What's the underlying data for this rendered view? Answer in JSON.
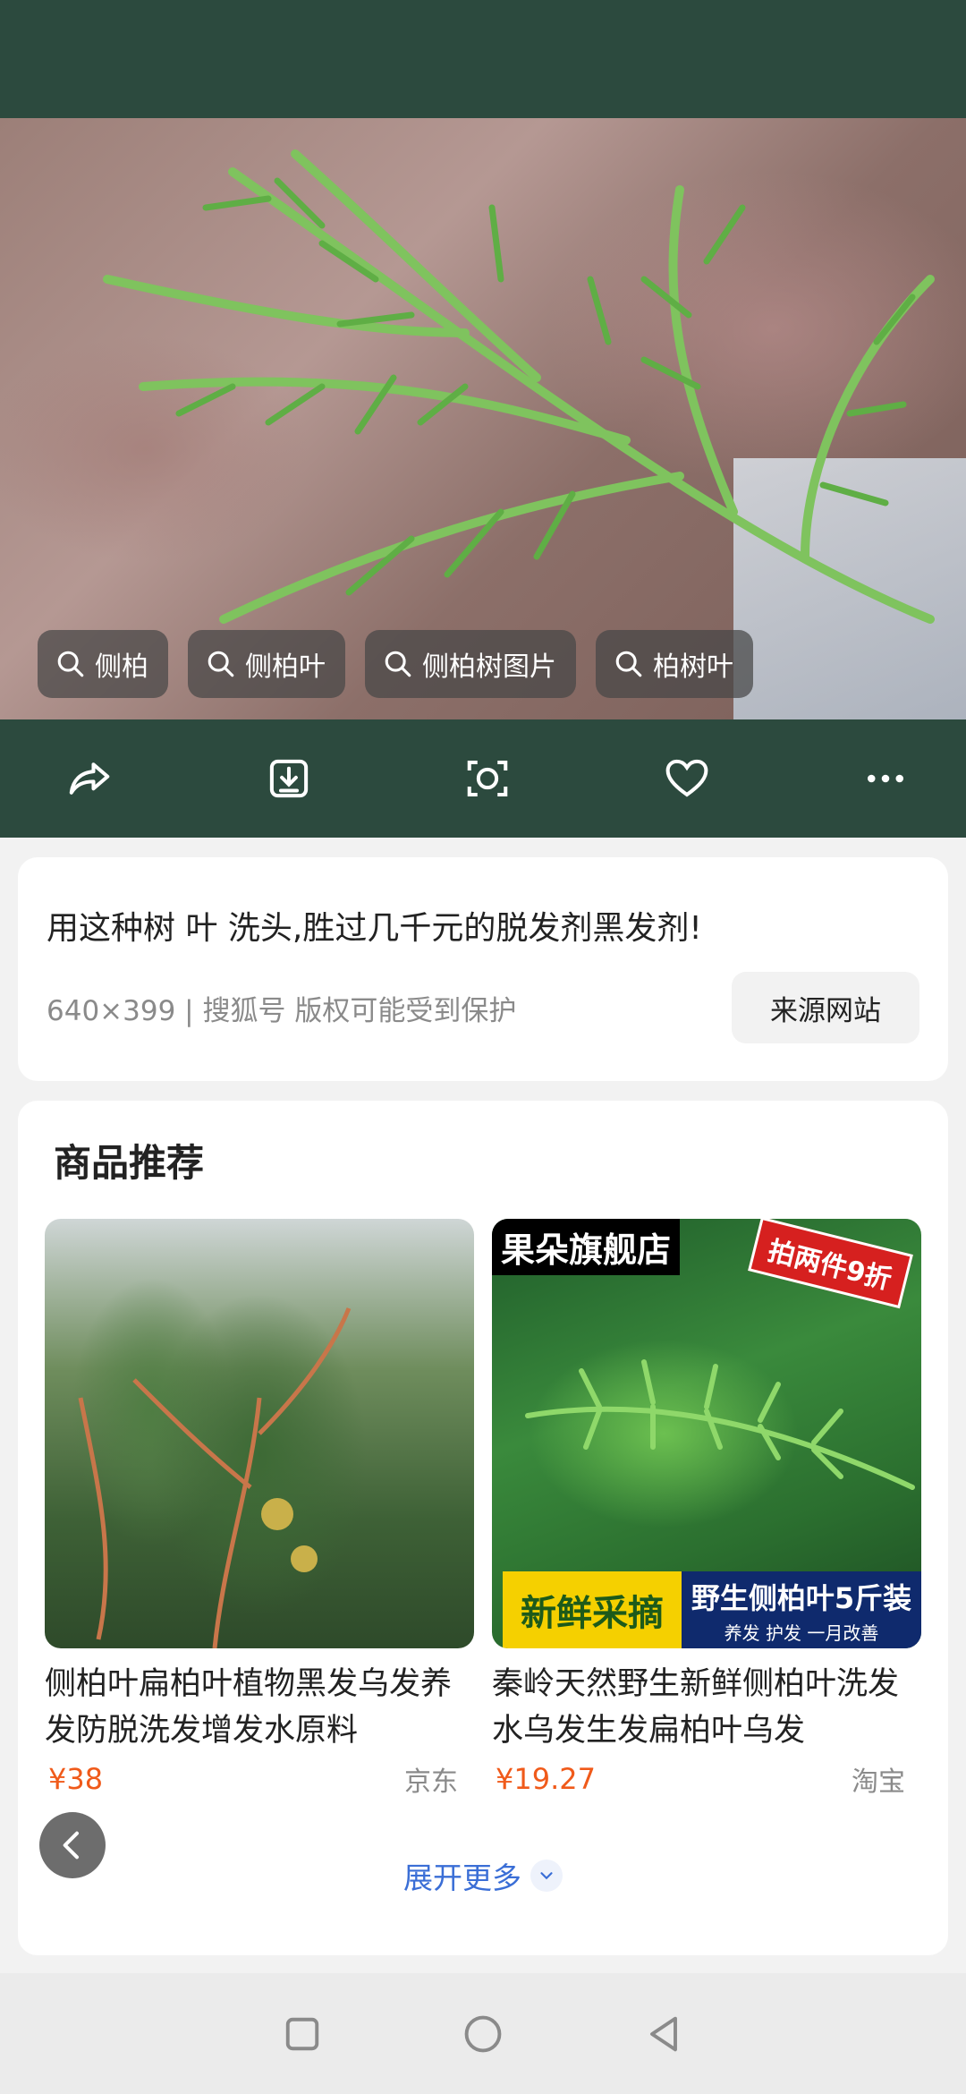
{
  "search_tags": [
    {
      "label": "侧柏"
    },
    {
      "label": "侧柏叶"
    },
    {
      "label": "侧柏树图片"
    },
    {
      "label": "柏树叶"
    }
  ],
  "image_info": {
    "title": "用这种树 叶 洗头,胜过几千元的脱发剂黑发剂!",
    "meta": "640×399 | 搜狐号 版权可能受到保护",
    "source_button": "来源网站"
  },
  "recommend": {
    "title": "商品推荐",
    "products": [
      {
        "name": "侧柏叶扁柏叶植物黑发乌发养发防脱洗发增发水原料",
        "price": "¥38",
        "shop": "京东"
      },
      {
        "name": "秦岭天然野生新鲜侧柏叶洗发水乌发生发扁柏叶乌发",
        "price": "¥19.27",
        "shop": "淘宝",
        "store_label": "果朵旗舰店",
        "promo": "拍两件9折",
        "badge_left": "新鲜采摘",
        "badge_right": "野生侧柏叶5斤装",
        "badge_sub": "养发 护发 一月改善"
      }
    ],
    "expand_label": "展开更多"
  },
  "colors": {
    "accent": "#3a6ed6",
    "price": "#f05a1a",
    "bar": "#2c4a3e"
  }
}
